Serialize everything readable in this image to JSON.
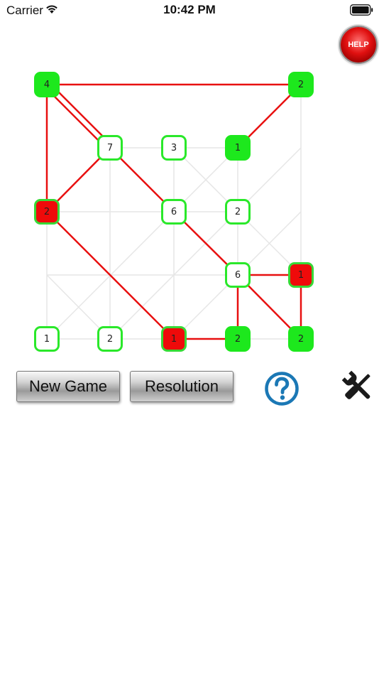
{
  "status_bar": {
    "carrier": "Carrier",
    "time": "10:42 PM"
  },
  "help_button": {
    "label": "HELP"
  },
  "board": {
    "nodes": [
      {
        "id": "n4-a",
        "value": "4",
        "state": "full"
      },
      {
        "id": "n2-b",
        "value": "2",
        "state": "full"
      },
      {
        "id": "n7",
        "value": "7",
        "state": "open"
      },
      {
        "id": "n3",
        "value": "3",
        "state": "open"
      },
      {
        "id": "n1-c",
        "value": "1",
        "state": "full"
      },
      {
        "id": "n2-d",
        "value": "2",
        "state": "error"
      },
      {
        "id": "n6-e",
        "value": "6",
        "state": "open"
      },
      {
        "id": "n2-f",
        "value": "2",
        "state": "open"
      },
      {
        "id": "n6-g",
        "value": "6",
        "state": "open"
      },
      {
        "id": "n1-h",
        "value": "1",
        "state": "error"
      },
      {
        "id": "n1-i",
        "value": "1",
        "state": "open"
      },
      {
        "id": "n2-j",
        "value": "2",
        "state": "open"
      },
      {
        "id": "n1-k",
        "value": "1",
        "state": "error"
      },
      {
        "id": "n2-l",
        "value": "2",
        "state": "full"
      },
      {
        "id": "n2-m",
        "value": "2",
        "state": "full"
      }
    ],
    "colors": {
      "bridge": "#e81010",
      "grid": "#e6e6e6",
      "node_border": "#2ae82a",
      "node_full": "#1de81d",
      "node_error": "#ef0a0a"
    }
  },
  "controls": {
    "new_game": "New Game",
    "resolution": "Resolution",
    "question_icon": "question-icon",
    "tools_icon": "wrench-screwdriver-icon"
  }
}
